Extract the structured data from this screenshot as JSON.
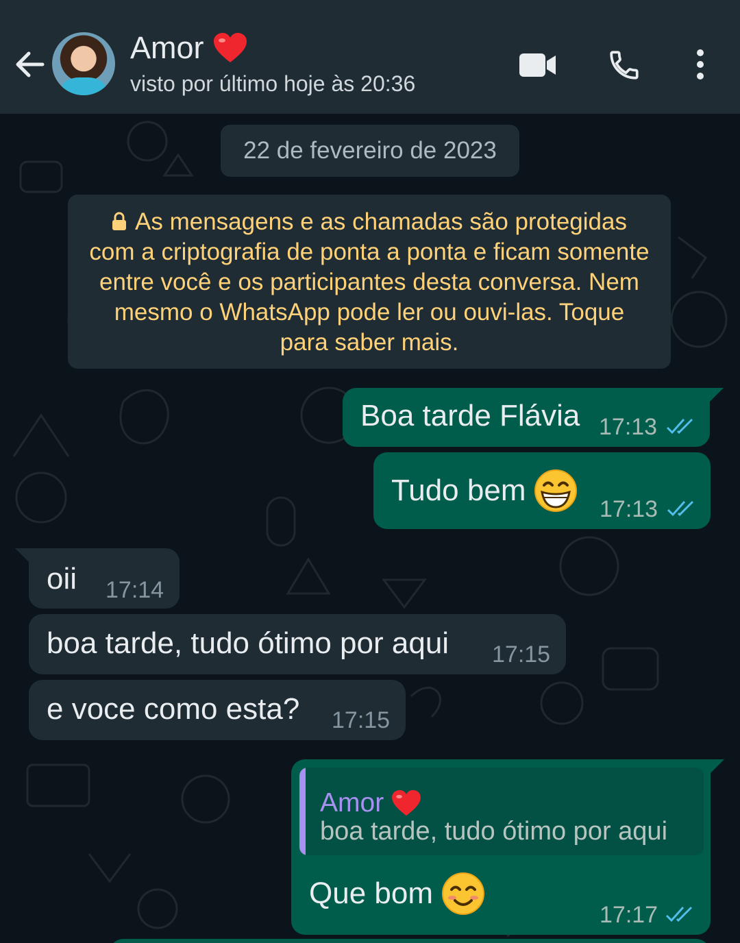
{
  "header": {
    "contact_name": "Amor",
    "status": "visto por último hoje às 20:36",
    "icons": [
      "back-arrow-icon",
      "video-call-icon",
      "voice-call-icon",
      "more-options-icon"
    ]
  },
  "chat": {
    "date_label": "22 de fevereiro de 2023",
    "encryption_notice": "As mensagens e as chamadas são protegidas com a criptografia de ponta a ponta e ficam somente entre você e os participantes desta conversa. Nem mesmo o WhatsApp pode ler ou ouvi-las. Toque para saber mais.",
    "messages": [
      {
        "direction": "out",
        "text": "Boa tarde Flávia",
        "time": "17:13",
        "read": true
      },
      {
        "direction": "out",
        "text": "Tudo bem",
        "emoji": "grinning-face",
        "time": "17:13",
        "read": true
      },
      {
        "direction": "in",
        "text": "oii",
        "time": "17:14"
      },
      {
        "direction": "in",
        "text": "boa tarde, tudo ótimo por aqui",
        "time": "17:15"
      },
      {
        "direction": "in",
        "text": "e voce como esta?",
        "time": "17:15"
      },
      {
        "direction": "out",
        "text": "Que bom",
        "emoji": "smiling-face",
        "time": "17:17",
        "read": true,
        "reply_to": {
          "name": "Amor",
          "text": "boa tarde, tudo ótimo por aqui"
        }
      }
    ]
  },
  "colors": {
    "header_bg": "#1f2c34",
    "chat_bg": "#0b141a",
    "outgoing_bubble": "#005c4b",
    "incoming_bubble": "#1f2c34",
    "encryption_text": "#ffd279",
    "read_ticks": "#53bdeb",
    "reply_accent": "#a791f0"
  }
}
